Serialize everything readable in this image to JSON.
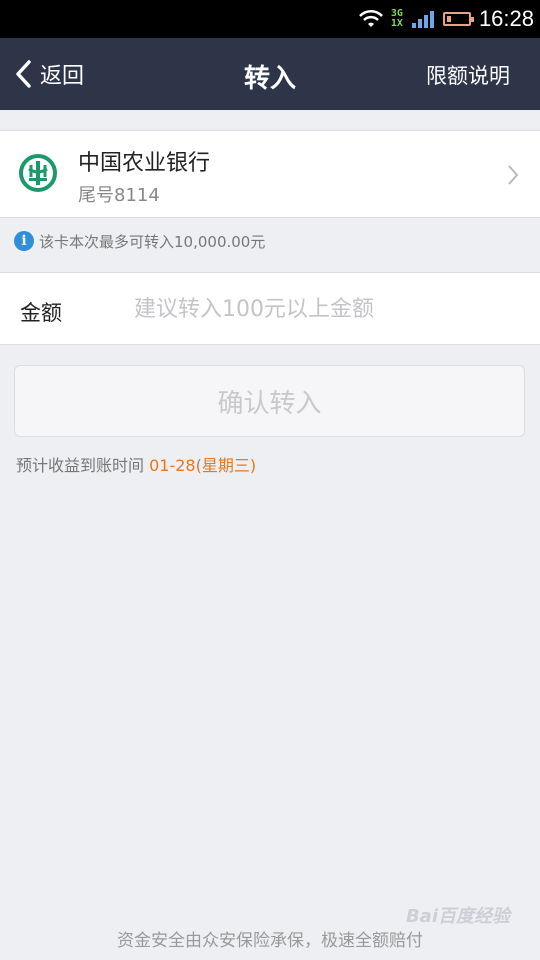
{
  "status_bar": {
    "network_top": "3G",
    "network_bottom": "1X",
    "time": "16:28"
  },
  "nav": {
    "back_label": "返回",
    "title": "转入",
    "right_label": "限额说明"
  },
  "bank": {
    "name": "中国农业银行",
    "tail": "尾号8114",
    "logo_color": "#1a9a6b"
  },
  "tip": {
    "text": "该卡本次最多可转入10,000.00元"
  },
  "amount": {
    "label": "金额",
    "value": "",
    "placeholder": "建议转入100元以上金额"
  },
  "confirm": {
    "label": "确认转入"
  },
  "eta": {
    "prefix": "预计收益到账时间 ",
    "date": "01-28(星期三)"
  },
  "footer": {
    "text": "资金安全由众安保险承保，极速全额赔付"
  },
  "watermark": {
    "text": "Bai百度经验"
  },
  "colors": {
    "nav_bg": "#2e3548",
    "accent_orange": "#e5781e",
    "info_blue": "#2f8fd8",
    "page_bg": "#eeeff3"
  }
}
